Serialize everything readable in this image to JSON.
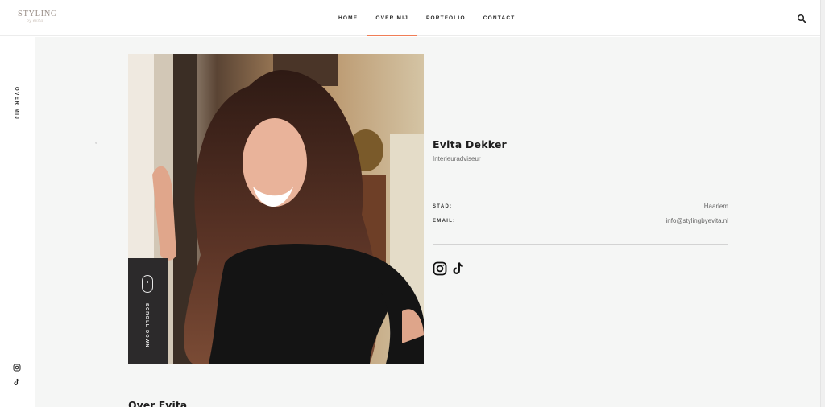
{
  "brand": {
    "logo_text": "STYLING",
    "logo_sub": "by evita"
  },
  "nav": {
    "items": [
      {
        "label": "HOME",
        "active": false
      },
      {
        "label": "OVER MIJ",
        "active": true
      },
      {
        "label": "PORTFOLIO",
        "active": false
      },
      {
        "label": "CONTACT",
        "active": false
      }
    ],
    "search_icon": "search-icon",
    "accent_color": "#f07d56"
  },
  "rail": {
    "label": "OVER MIJ",
    "icons": [
      "instagram-icon",
      "tiktok-icon"
    ]
  },
  "profile": {
    "name": "Evita Dekker",
    "role": "Interieuradviseur",
    "fields": [
      {
        "label": "STAD:",
        "value": "Haarlem"
      },
      {
        "label": "EMAIL:",
        "value": "info@stylingbyevita.nl"
      }
    ],
    "socials": [
      "instagram-icon",
      "tiktok-icon"
    ]
  },
  "scroll": {
    "label": "SCROLL DOWN"
  },
  "section": {
    "title": "Over Evita"
  }
}
